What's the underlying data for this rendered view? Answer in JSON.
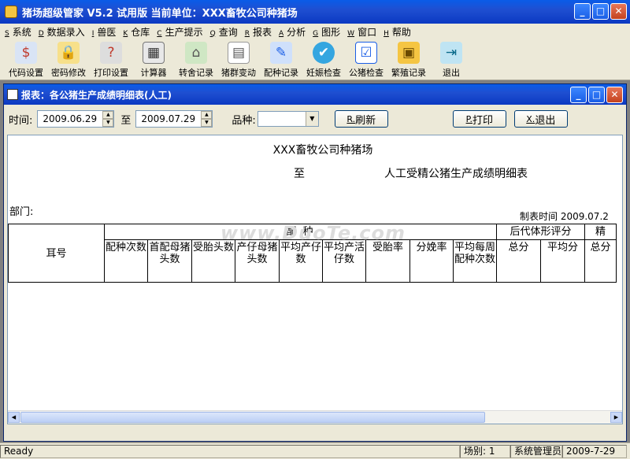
{
  "app": {
    "title": "猪场超级管家 V5.2 试用版   当前单位：XXX畜牧公司种猪场"
  },
  "menu": [
    {
      "key": "S",
      "label": "系统"
    },
    {
      "key": "D",
      "label": "数据录入"
    },
    {
      "key": "I",
      "label": "兽医"
    },
    {
      "key": "K",
      "label": "仓库"
    },
    {
      "key": "C",
      "label": "生产提示"
    },
    {
      "key": "Q",
      "label": "查询"
    },
    {
      "key": "R",
      "label": "报表"
    },
    {
      "key": "A",
      "label": "分析"
    },
    {
      "key": "G",
      "label": "图形"
    },
    {
      "key": "W",
      "label": "窗口"
    },
    {
      "key": "H",
      "label": "帮助"
    }
  ],
  "toolbar": [
    {
      "label": "代码设置",
      "icon": "code-settings-icon"
    },
    {
      "label": "密码修改",
      "icon": "lock-icon"
    },
    {
      "label": "打印设置",
      "icon": "printer-icon"
    },
    {
      "label": "计算器",
      "icon": "calculator-icon"
    },
    {
      "label": "转舍记录",
      "icon": "house-icon"
    },
    {
      "label": "猪群变动",
      "icon": "document-icon"
    },
    {
      "label": "配种记录",
      "icon": "breeding-icon"
    },
    {
      "label": "妊娠检查",
      "icon": "check-icon"
    },
    {
      "label": "公猪检查",
      "icon": "inspect-icon"
    },
    {
      "label": "繁殖记录",
      "icon": "record-icon"
    },
    {
      "label": "退出",
      "icon": "exit-icon"
    }
  ],
  "report_window": {
    "title": "报表：各公猪生产成绩明细表(人工)",
    "time_label": "时间:",
    "date_from": "2009.06.29",
    "to_label": "至",
    "date_to": "2009.07.29",
    "breed_label": "品种:",
    "breed_value": "",
    "refresh_key": "R.",
    "refresh_label": "刷新",
    "print_key": "P.",
    "print_label": "打印",
    "exit_key": "X.",
    "exit_label": "退出"
  },
  "report": {
    "org": "XXX畜牧公司种猪场",
    "to": "至",
    "name": "人工受精公猪生产成绩明细表",
    "dept_label": "部门:",
    "made_time": "制表时间 2009.07.2",
    "watermark": "www.DuoTe.com",
    "headers": {
      "ear": "耳号",
      "mating_group": "配    种",
      "offspring_group": "后代体形评分",
      "cut_group": "精",
      "cols": [
        "配种次数",
        "首配母猪头数",
        "受胎头数",
        "产仔母猪头数",
        "平均产仔数",
        "平均产活仔数",
        "受胎率",
        "分娩率",
        "平均每周配种次数",
        "总分",
        "平均分",
        "总分"
      ]
    }
  },
  "status": {
    "ready": "Ready",
    "farm": "场别: 1",
    "user": "系统管理员",
    "date": "2009-7-29"
  }
}
